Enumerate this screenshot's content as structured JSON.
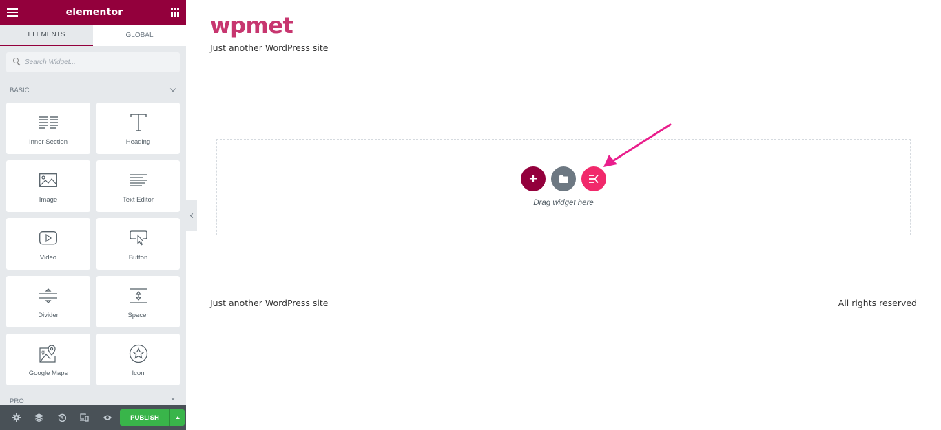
{
  "panel": {
    "logo": "elementor",
    "tabs": [
      {
        "label": "ELEMENTS",
        "active": true
      },
      {
        "label": "GLOBAL",
        "active": false
      }
    ],
    "search": {
      "placeholder": "Search Widget..."
    },
    "categories": {
      "basic": "BASIC",
      "pro": "PRO"
    },
    "widgets": [
      {
        "label": "Inner Section",
        "icon": "inner-section-icon"
      },
      {
        "label": "Heading",
        "icon": "heading-icon"
      },
      {
        "label": "Image",
        "icon": "image-icon"
      },
      {
        "label": "Text Editor",
        "icon": "text-editor-icon"
      },
      {
        "label": "Video",
        "icon": "video-icon"
      },
      {
        "label": "Button",
        "icon": "button-icon"
      },
      {
        "label": "Divider",
        "icon": "divider-icon"
      },
      {
        "label": "Spacer",
        "icon": "spacer-icon"
      },
      {
        "label": "Google Maps",
        "icon": "google-maps-icon"
      },
      {
        "label": "Icon",
        "icon": "star-icon"
      }
    ],
    "footer": {
      "publish_label": "PUBLISH",
      "icons": [
        "settings-icon",
        "navigator-icon",
        "history-icon",
        "responsive-icon",
        "preview-icon"
      ]
    }
  },
  "preview": {
    "site_title": "wpmet",
    "site_description": "Just another WordPress site",
    "dropzone": {
      "drag_text": "Drag widget here",
      "add_icon": "+",
      "ek_icon": "EK"
    },
    "footer": {
      "left": "Just another WordPress site",
      "right": "All rights reserved"
    }
  },
  "colors": {
    "brand": "#93003c",
    "accent_pink": "#f1296b",
    "publish_green": "#39b54a",
    "site_title": "#c7366f",
    "arrow": "#e91e8c"
  }
}
